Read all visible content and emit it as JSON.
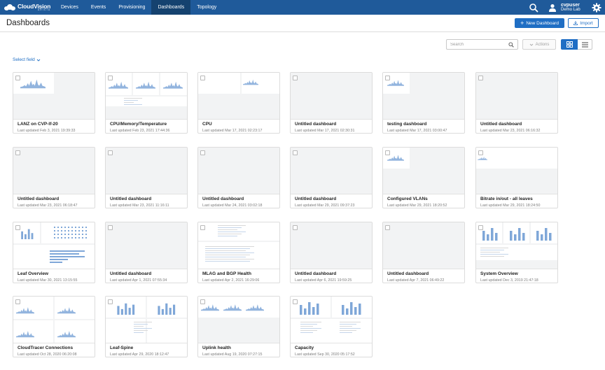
{
  "nav": {
    "logo_text": "CloudVision",
    "logo_sub": "ARISTA",
    "items": [
      {
        "label": "Devices",
        "active": false
      },
      {
        "label": "Events",
        "active": false
      },
      {
        "label": "Provisioning",
        "active": false
      },
      {
        "label": "Dashboards",
        "active": true
      },
      {
        "label": "Topology",
        "active": false
      }
    ],
    "user": "cvpuser",
    "user_sub": "Demo Lab"
  },
  "header": {
    "title": "Dashboards",
    "new_label": "New Dashboard",
    "import_label": "Import"
  },
  "toolbar": {
    "search_placeholder": "Search",
    "actions_label": "Actions",
    "select_field_label": "Select field"
  },
  "colors": {
    "nav": "#1f5a9a",
    "nav_active": "#15426f",
    "accent": "#1f6ec4",
    "chart": "#7fa7d8"
  },
  "cards": [
    {
      "name": "LANZ on CVP-lf-20",
      "date": "Last updated Feb 3, 2021 19:39:33",
      "thumb": "spark-left"
    },
    {
      "name": "CPU/Memory/Temperature",
      "date": "Last updated Feb 23, 2021 17:44:36",
      "thumb": "triple"
    },
    {
      "name": "CPU",
      "date": "Last updated Mar 17, 2021 02:23:17",
      "thumb": "spark-mid"
    },
    {
      "name": "Untitled dashboard",
      "date": "Last updated Mar 17, 2021 02:30:31",
      "thumb": "empty"
    },
    {
      "name": "testing dashboard",
      "date": "Last updated Mar 17, 2021 03:00:47",
      "thumb": "spark-small"
    },
    {
      "name": "Untitled dashboard",
      "date": "Last updated Mar 23, 2021 06:16:32",
      "thumb": "empty"
    },
    {
      "name": "Untitled dashboard",
      "date": "Last updated Mar 23, 2021 06:18:47",
      "thumb": "empty"
    },
    {
      "name": "Untitled dashboard",
      "date": "Last updated Mar 23, 2021 11:16:11",
      "thumb": "empty"
    },
    {
      "name": "Untitled dashboard",
      "date": "Last updated Mar 24, 2021 03:02:18",
      "thumb": "empty"
    },
    {
      "name": "Untitled dashboard",
      "date": "Last updated Mar 29, 2021 09:37:23",
      "thumb": "empty"
    },
    {
      "name": "Configured VLANs",
      "date": "Last updated Mar 29, 2021 18:20:52",
      "thumb": "spark-small"
    },
    {
      "name": "Bitrate in/out - all leaves",
      "date": "Last updated Mar 29, 2021 18:24:50",
      "thumb": "wide"
    },
    {
      "name": "Leaf Overview",
      "date": "Last updated Mar 30, 2021 13:15:55",
      "thumb": "leaf"
    },
    {
      "name": "Untitled dashboard",
      "date": "Last updated Apr 1, 2021 07:55:34",
      "thumb": "empty"
    },
    {
      "name": "MLAG and BGP Health",
      "date": "Last updated Apr 2, 2021 16:29:06",
      "thumb": "table"
    },
    {
      "name": "Untitled dashboard",
      "date": "Last updated Apr 6, 2021 19:59:25",
      "thumb": "empty"
    },
    {
      "name": "Untitled dashboard",
      "date": "Last updated Apr 7, 2021 06:49:22",
      "thumb": "empty"
    },
    {
      "name": "System Overview",
      "date": "Last updated Dec 3, 2019 21:47:18",
      "thumb": "bars3"
    },
    {
      "name": "CloudTracer Connections",
      "date": "Last updated Oct 28, 2020 06:20:08",
      "thumb": "quad"
    },
    {
      "name": "Leaf-Spine",
      "date": "Last updated Apr 29, 2020 18:12:47",
      "thumb": "bars2"
    },
    {
      "name": "Uplink health",
      "date": "Last updated Aug 19, 2020 07:27:15",
      "thumb": "spark-row"
    },
    {
      "name": "Capacity",
      "date": "Last updated Sep 30, 2020 05:17:52",
      "thumb": "bars-table"
    }
  ]
}
